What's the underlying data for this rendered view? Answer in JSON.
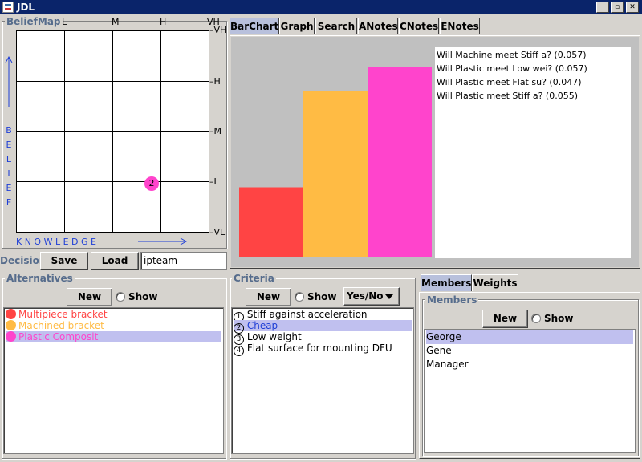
{
  "window": {
    "title": "JDL",
    "min": "_",
    "max": "▫",
    "close": "✕"
  },
  "belief_map": {
    "title": "BeliefMap",
    "x_ticks": [
      "L",
      "M",
      "H",
      "VH"
    ],
    "y_ticks": [
      "VH",
      "H",
      "M",
      "L",
      "VL"
    ],
    "y_axis_letters": [
      "B",
      "E",
      "L",
      "I",
      "E",
      "F"
    ],
    "x_axis_label": "K N O W L E D G E",
    "marker": {
      "label": "2",
      "color": "#ff44cc"
    }
  },
  "decision": {
    "label": "Decision",
    "save": "Save",
    "load": "Load",
    "value": "ipteam"
  },
  "tabs": [
    "BarChart",
    "Graph",
    "Search",
    "ANotes",
    "CNotes",
    "ENotes"
  ],
  "chart_data": {
    "type": "bar",
    "categories": [
      "Multipiece bracket",
      "Machined bracket",
      "Plastic Composit"
    ],
    "values": [
      0.35,
      0.83,
      0.95
    ],
    "colors": [
      "#ff4444",
      "#ffbb44",
      "#ff44cc"
    ],
    "ylim": [
      0,
      1
    ],
    "notes": [
      "Will Machine meet Stiff a? (0.057)",
      "Will Plastic meet Low wei? (0.057)",
      "Will Plastic meet Flat su? (0.047)",
      "Will Plastic meet Stiff a? (0.055)"
    ]
  },
  "alternatives": {
    "title": "Alternatives",
    "new": "New",
    "show": "Show",
    "items": [
      {
        "label": "Multipiece bracket",
        "color": "#ff4444"
      },
      {
        "label": "Machined bracket",
        "color": "#ffbb44"
      },
      {
        "label": "Plastic Composit",
        "color": "#ff44cc"
      }
    ]
  },
  "criteria": {
    "title": "Criteria",
    "new": "New",
    "show": "Show",
    "dropdown": "Yes/No",
    "items": [
      {
        "num": "1",
        "label": "Stiff against acceleration"
      },
      {
        "num": "2",
        "label": "Cheap"
      },
      {
        "num": "3",
        "label": "Low weight"
      },
      {
        "num": "4",
        "label": "Flat surface for mounting DFU"
      }
    ]
  },
  "members_panel": {
    "tabs": [
      "Members",
      "Weights"
    ],
    "title": "Members",
    "new": "New",
    "show": "Show",
    "items": [
      "George",
      "Gene",
      "Manager"
    ]
  }
}
